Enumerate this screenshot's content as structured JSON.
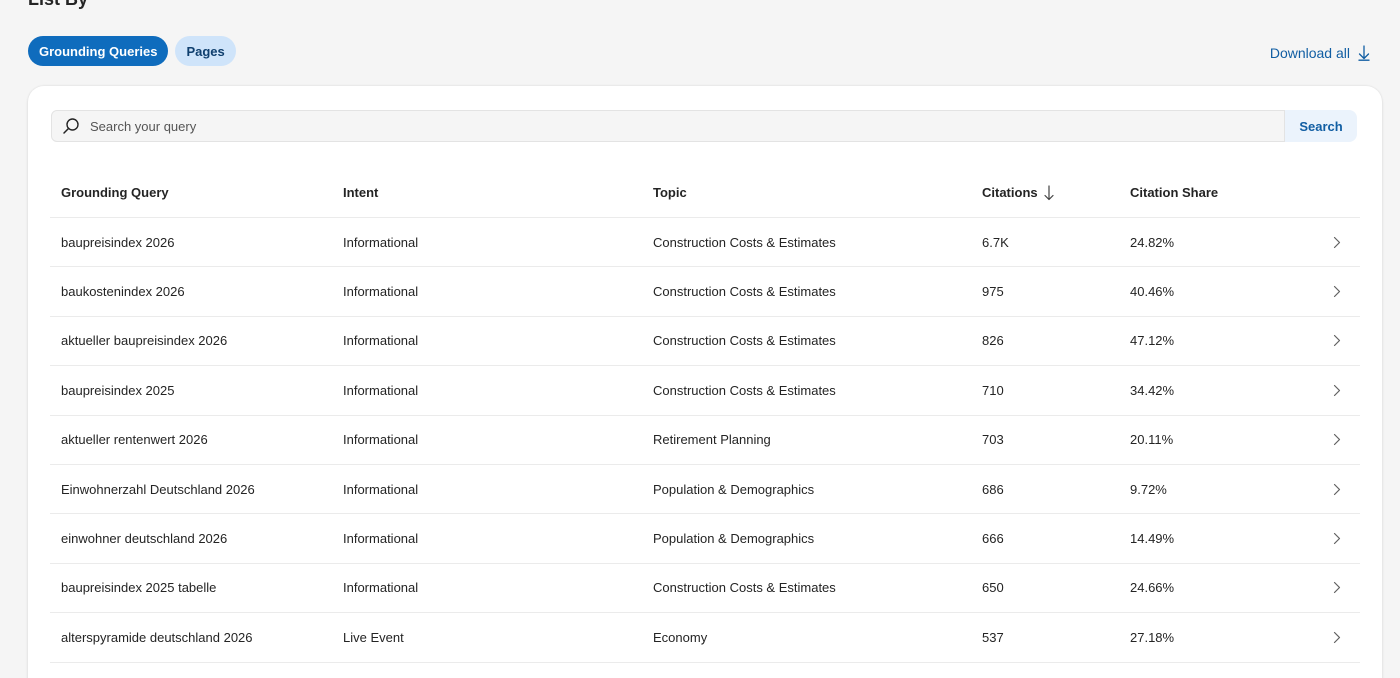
{
  "heading": "List By",
  "toggle": {
    "active": "Grounding Queries",
    "inactive": "Pages"
  },
  "download": {
    "label": "Download all",
    "icon": "download-icon"
  },
  "search": {
    "placeholder": "Search your query",
    "button": "Search",
    "icon": "search-icon"
  },
  "table": {
    "columns": {
      "query": "Grounding Query",
      "intent": "Intent",
      "topic": "Topic",
      "citations": "Citations",
      "share": "Citation Share"
    },
    "sort_icon": "arrow-down-icon",
    "row_icon": "chevron-right-icon",
    "rows": [
      {
        "query": "baupreisindex 2026",
        "intent": "Informational",
        "topic": "Construction Costs & Estimates",
        "citations": "6.7K",
        "share": "24.82%"
      },
      {
        "query": "baukostenindex 2026",
        "intent": "Informational",
        "topic": "Construction Costs & Estimates",
        "citations": "975",
        "share": "40.46%"
      },
      {
        "query": "aktueller baupreisindex 2026",
        "intent": "Informational",
        "topic": "Construction Costs & Estimates",
        "citations": "826",
        "share": "47.12%"
      },
      {
        "query": "baupreisindex 2025",
        "intent": "Informational",
        "topic": "Construction Costs & Estimates",
        "citations": "710",
        "share": "34.42%"
      },
      {
        "query": "aktueller rentenwert 2026",
        "intent": "Informational",
        "topic": "Retirement Planning",
        "citations": "703",
        "share": "20.11%"
      },
      {
        "query": "Einwohnerzahl Deutschland 2026",
        "intent": "Informational",
        "topic": "Population & Demographics",
        "citations": "686",
        "share": "9.72%"
      },
      {
        "query": "einwohner deutschland 2026",
        "intent": "Informational",
        "topic": "Population & Demographics",
        "citations": "666",
        "share": "14.49%"
      },
      {
        "query": "baupreisindex 2025 tabelle",
        "intent": "Informational",
        "topic": "Construction Costs & Estimates",
        "citations": "650",
        "share": "24.66%"
      },
      {
        "query": "alterspyramide deutschland 2026",
        "intent": "Live Event",
        "topic": "Economy",
        "citations": "537",
        "share": "27.18%"
      }
    ]
  },
  "colors": {
    "accent": "#0f6cbd",
    "accent_light": "#cfe4fa",
    "link": "#115ea3",
    "background": "#f5f5f5"
  }
}
